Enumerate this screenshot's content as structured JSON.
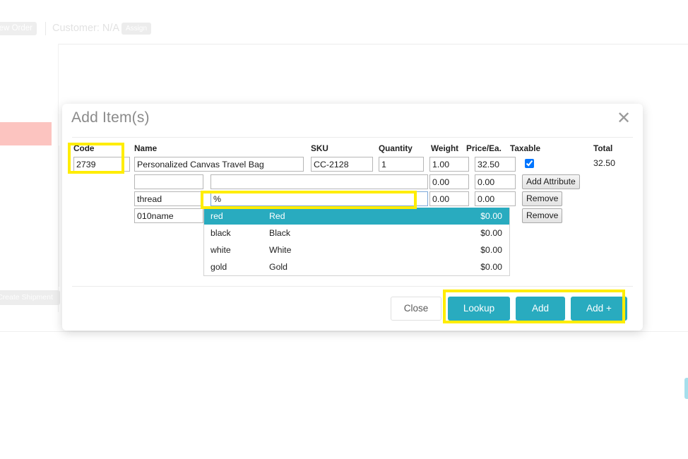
{
  "background": {
    "new_order_button": "New Order",
    "customer_label": "Customer: N/A",
    "assign_button": "Assign",
    "create_shipment_button": "Create Shipment"
  },
  "modal": {
    "title": "Add Item(s)",
    "close_icon": "close-icon",
    "columns": [
      "Code",
      "Name",
      "SKU",
      "Quantity",
      "Weight",
      "Price/Ea.",
      "Taxable",
      "Total"
    ],
    "item_row": {
      "code": "2739",
      "name": "Personalized Canvas Travel Bag",
      "sku": "CC-2128",
      "quantity": "1",
      "weight": "1.00",
      "price_each": "32.50",
      "taxable_checked": true,
      "total": "32.50"
    },
    "attribute_rows": [
      {
        "code": "",
        "value": "",
        "weight": "0.00",
        "price": "0.00",
        "action_label": "Add Attribute",
        "focused": false
      },
      {
        "code": "thread",
        "value": "%",
        "weight": "0.00",
        "price": "0.00",
        "action_label": "Remove",
        "focused": true
      },
      {
        "code": "010name",
        "value": "",
        "weight": "",
        "price": "",
        "action_label": "Remove",
        "focused": false
      }
    ],
    "suggestions": [
      {
        "code": "red",
        "name": "Red",
        "price": "$0.00",
        "active": true
      },
      {
        "code": "black",
        "name": "Black",
        "price": "$0.00",
        "active": false
      },
      {
        "code": "white",
        "name": "White",
        "price": "$0.00",
        "active": false
      },
      {
        "code": "gold",
        "name": "Gold",
        "price": "$0.00",
        "active": false
      }
    ],
    "footer": {
      "close": "Close",
      "lookup": "Lookup",
      "add": "Add",
      "add_plus": "Add +"
    }
  },
  "colors": {
    "accent_teal": "#29abbf",
    "highlight_yellow": "#ffed00",
    "alert_pink": "#fcc4c0",
    "right_tab_blue": "#a6dfec"
  }
}
